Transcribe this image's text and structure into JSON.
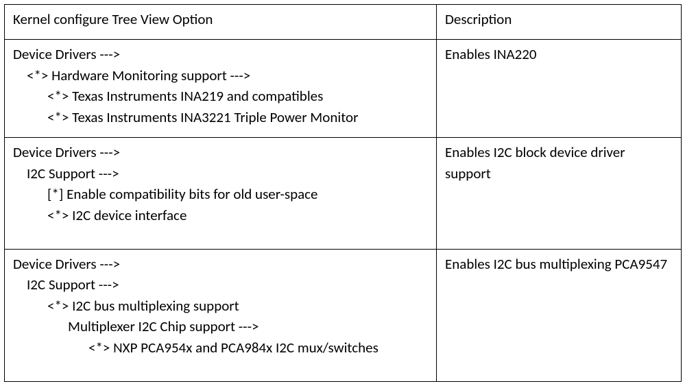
{
  "headers": {
    "option": "Kernel configure Tree View Option",
    "description": "Description"
  },
  "rows": [
    {
      "option_lines": [
        {
          "indent": 0,
          "text": "Device Drivers --->"
        },
        {
          "indent": 1,
          "text": "<*> Hardware Monitoring support --->"
        },
        {
          "indent": 2,
          "text": "<*> Texas Instruments INA219 and compatibles"
        },
        {
          "indent": 2,
          "text": "<*> Texas Instruments INA3221 Triple Power Monitor"
        }
      ],
      "description": "Enables INA220"
    },
    {
      "option_lines": [
        {
          "indent": 0,
          "text": "Device Drivers --->"
        },
        {
          "indent": 1,
          "text": "I2C Support --->"
        },
        {
          "indent": 2,
          "text": "[*] Enable compatibility bits for old user-space"
        },
        {
          "indent": 2,
          "text": "<*> I2C device interface"
        },
        {
          "indent": 0,
          "text": "",
          "spacer": true
        }
      ],
      "description": "Enables I2C block device driver support"
    },
    {
      "option_lines": [
        {
          "indent": 0,
          "text": "Device Drivers --->"
        },
        {
          "indent": 1,
          "text": "I2C Support --->"
        },
        {
          "indent": 2,
          "text": "<*> I2C bus multiplexing support"
        },
        {
          "indent": 3,
          "text": "Multiplexer I2C Chip support  --->"
        },
        {
          "indent": 4,
          "text": "<*> NXP PCA954x and PCA984x I2C mux/switches"
        },
        {
          "indent": 0,
          "text": "",
          "spacer": true
        }
      ],
      "description": "Enables I2C bus multiplexing PCA9547"
    }
  ]
}
